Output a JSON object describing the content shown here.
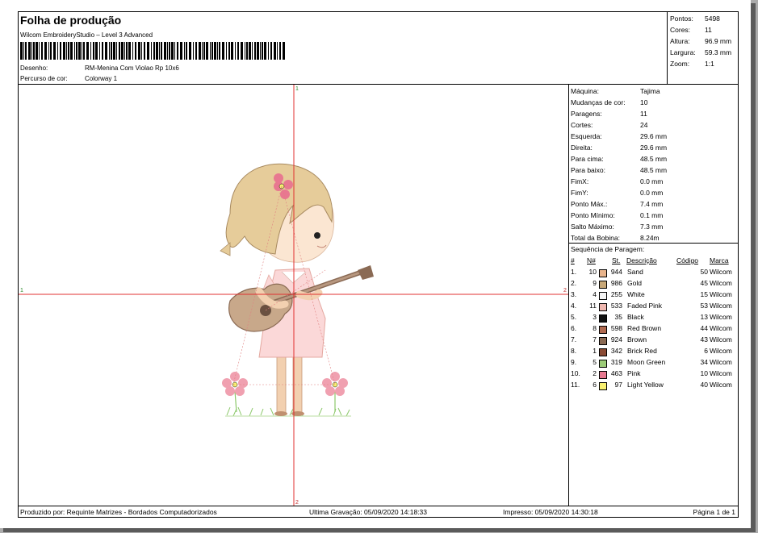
{
  "header": {
    "title": "Folha de produção",
    "software": "Wilcom EmbroideryStudio – Level 3 Advanced",
    "design_label": "Desenho:",
    "design_value": "RM-Menina Com Violao Rp 10x6",
    "colorway_label": "Percurso de cor:",
    "colorway_value": "Colorway 1"
  },
  "stats": [
    {
      "label": "Pontos:",
      "value": "5498"
    },
    {
      "label": "Cores:",
      "value": "11"
    },
    {
      "label": "Altura:",
      "value": "96.9 mm"
    },
    {
      "label": "Largura:",
      "value": "59.3 mm"
    },
    {
      "label": "Zoom:",
      "value": "1:1"
    }
  ],
  "canvas": {
    "markers": {
      "top": "1",
      "bottom": "2",
      "left": "1",
      "right": "2"
    },
    "guide_color": "#e03030"
  },
  "machine_info": [
    {
      "label": "Máquina:",
      "value": "Tajima"
    },
    {
      "label": "Mudanças de cor:",
      "value": "10"
    },
    {
      "label": "Paragens:",
      "value": "11"
    },
    {
      "label": "Cortes:",
      "value": "24"
    },
    {
      "label": "Esquerda:",
      "value": "29.6 mm"
    },
    {
      "label": "Direita:",
      "value": "29.6 mm"
    },
    {
      "label": "Para cima:",
      "value": "48.5 mm"
    },
    {
      "label": "Para baixo:",
      "value": "48.5 mm"
    },
    {
      "label": "FimX:",
      "value": "0.0 mm"
    },
    {
      "label": "FimY:",
      "value": "0.0 mm"
    },
    {
      "label": "Ponto Máx.:",
      "value": "7.4 mm"
    },
    {
      "label": "Ponto Mínimo:",
      "value": "0.1 mm"
    },
    {
      "label": "Salto Máximo:",
      "value": "7.3 mm"
    },
    {
      "label": "Total da Bobina:",
      "value": "8.24m"
    }
  ],
  "stop_sequence": {
    "title": "Sequência de Paragem:",
    "headers": {
      "idx": "#",
      "n": "N#",
      "st": "St.",
      "desc": "Descrição",
      "code": "Código",
      "brand": "Marca"
    },
    "rows": [
      {
        "idx": "1.",
        "n": "10",
        "st": "944",
        "desc": "Sand",
        "code": "50",
        "brand": "Wilcom",
        "color": "#e8b48c"
      },
      {
        "idx": "2.",
        "n": "9",
        "st": "986",
        "desc": "Gold",
        "code": "45",
        "brand": "Wilcom",
        "color": "#c8a878"
      },
      {
        "idx": "3.",
        "n": "4",
        "st": "255",
        "desc": "White",
        "code": "15",
        "brand": "Wilcom",
        "color": "#f4f4f4"
      },
      {
        "idx": "4.",
        "n": "11",
        "st": "533",
        "desc": "Faded Pink",
        "code": "53",
        "brand": "Wilcom",
        "color": "#f0b8b0"
      },
      {
        "idx": "5.",
        "n": "3",
        "st": "35",
        "desc": "Black",
        "code": "13",
        "brand": "Wilcom",
        "color": "#111111"
      },
      {
        "idx": "6.",
        "n": "8",
        "st": "598",
        "desc": "Red Brown",
        "code": "44",
        "brand": "Wilcom",
        "color": "#b06a50"
      },
      {
        "idx": "7.",
        "n": "7",
        "st": "924",
        "desc": "Brown",
        "code": "43",
        "brand": "Wilcom",
        "color": "#8a6a54"
      },
      {
        "idx": "8.",
        "n": "1",
        "st": "342",
        "desc": "Brick Red",
        "code": "6",
        "brand": "Wilcom",
        "color": "#8a4a34"
      },
      {
        "idx": "9.",
        "n": "5",
        "st": "319",
        "desc": "Moon Green",
        "code": "34",
        "brand": "Wilcom",
        "color": "#9ccc78"
      },
      {
        "idx": "10.",
        "n": "2",
        "st": "463",
        "desc": "Pink",
        "code": "10",
        "brand": "Wilcom",
        "color": "#e87890"
      },
      {
        "idx": "11.",
        "n": "6",
        "st": "97",
        "desc": "Light Yellow",
        "code": "40",
        "brand": "Wilcom",
        "color": "#f8f070"
      }
    ]
  },
  "footer": {
    "producer": "Produzido por: Requinte Matrizes - Bordados Computadorizados",
    "last_saved": "Ultima Gravação: 05/09/2020 14:18:33",
    "printed": "Impresso: 05/09/2020 14:30:18",
    "page": "Página 1 de 1"
  }
}
